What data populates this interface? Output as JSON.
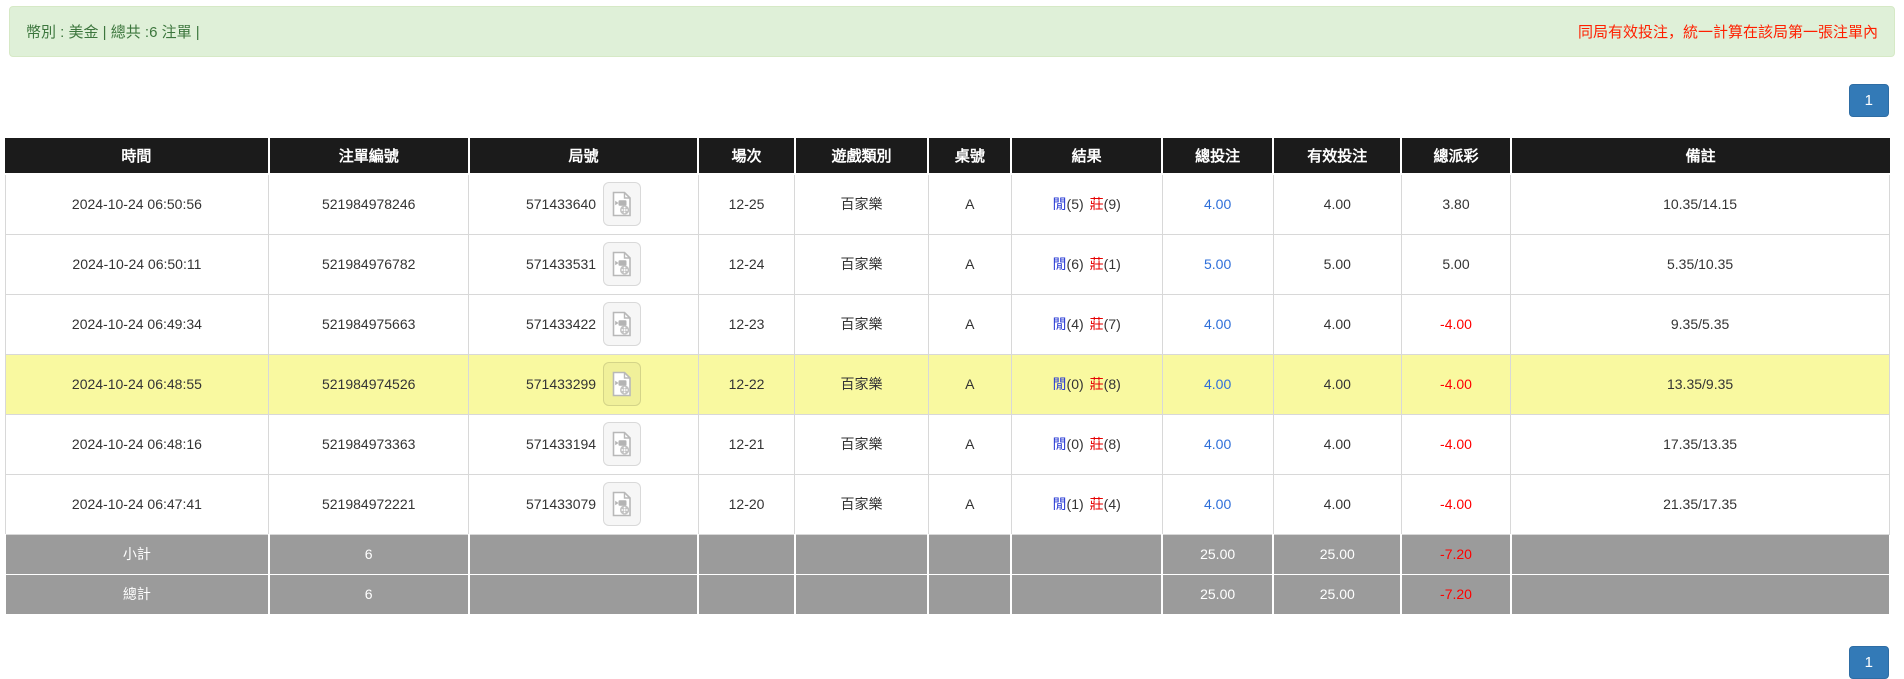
{
  "alert": {
    "left": "幣別 : 美金 | 總共 :6 注單 |",
    "right": "同局有效投注，統一計算在該局第一張注單內"
  },
  "pagination": {
    "page": "1"
  },
  "icons": {
    "video_replay": "video-replay-icon"
  },
  "table": {
    "headers": [
      "時間",
      "注單編號",
      "局號",
      "場次",
      "遊戲類別",
      "桌號",
      "結果",
      "總投注",
      "有效投注",
      "總派彩",
      "備註"
    ],
    "rows": [
      {
        "time": "2024-10-24 06:50:56",
        "bet_id": "521984978246",
        "round_id": "571433640",
        "session": "12-25",
        "game": "百家樂",
        "table_no": "A",
        "result": {
          "player": "閒",
          "player_score": "(5)",
          "banker": "莊",
          "banker_score": "(9)"
        },
        "total_bet": "4.00",
        "valid_bet": "4.00",
        "payout": "3.80",
        "remark": "10.35/14.15",
        "highlighted": false
      },
      {
        "time": "2024-10-24 06:50:11",
        "bet_id": "521984976782",
        "round_id": "571433531",
        "session": "12-24",
        "game": "百家樂",
        "table_no": "A",
        "result": {
          "player": "閒",
          "player_score": "(6)",
          "banker": "莊",
          "banker_score": "(1)"
        },
        "total_bet": "5.00",
        "valid_bet": "5.00",
        "payout": "5.00",
        "remark": "5.35/10.35",
        "highlighted": false
      },
      {
        "time": "2024-10-24 06:49:34",
        "bet_id": "521984975663",
        "round_id": "571433422",
        "session": "12-23",
        "game": "百家樂",
        "table_no": "A",
        "result": {
          "player": "閒",
          "player_score": "(4)",
          "banker": "莊",
          "banker_score": "(7)"
        },
        "total_bet": "4.00",
        "valid_bet": "4.00",
        "payout": "-4.00",
        "remark": "9.35/5.35",
        "highlighted": false
      },
      {
        "time": "2024-10-24 06:48:55",
        "bet_id": "521984974526",
        "round_id": "571433299",
        "session": "12-22",
        "game": "百家樂",
        "table_no": "A",
        "result": {
          "player": "閒",
          "player_score": "(0)",
          "banker": "莊",
          "banker_score": "(8)"
        },
        "total_bet": "4.00",
        "valid_bet": "4.00",
        "payout": "-4.00",
        "remark": "13.35/9.35",
        "highlighted": true
      },
      {
        "time": "2024-10-24 06:48:16",
        "bet_id": "521984973363",
        "round_id": "571433194",
        "session": "12-21",
        "game": "百家樂",
        "table_no": "A",
        "result": {
          "player": "閒",
          "player_score": "(0)",
          "banker": "莊",
          "banker_score": "(8)"
        },
        "total_bet": "4.00",
        "valid_bet": "4.00",
        "payout": "-4.00",
        "remark": "17.35/13.35",
        "highlighted": false
      },
      {
        "time": "2024-10-24 06:47:41",
        "bet_id": "521984972221",
        "round_id": "571433079",
        "session": "12-20",
        "game": "百家樂",
        "table_no": "A",
        "result": {
          "player": "閒",
          "player_score": "(1)",
          "banker": "莊",
          "banker_score": "(4)"
        },
        "total_bet": "4.00",
        "valid_bet": "4.00",
        "payout": "-4.00",
        "remark": "21.35/17.35",
        "highlighted": false
      }
    ],
    "subtotal": {
      "label": "小計",
      "count": "6",
      "total_bet": "25.00",
      "valid_bet": "25.00",
      "payout": "-7.20"
    },
    "total": {
      "label": "總計",
      "count": "6",
      "total_bet": "25.00",
      "valid_bet": "25.00",
      "payout": "-7.20"
    }
  },
  "colors": {
    "accent_blue": "#337ab7",
    "link_blue": "#2e6fd9",
    "player_blue": "#2638d4",
    "banker_red": "#e60000",
    "negative_red": "#ff0000",
    "highlight_yellow": "#f9f9a0",
    "header_black": "#1b1b1b",
    "summary_gray": "#9b9b9b",
    "alert_green_bg": "#dff0d8",
    "alert_green_text": "#3c763d",
    "alert_red_text": "#ff1f00"
  }
}
